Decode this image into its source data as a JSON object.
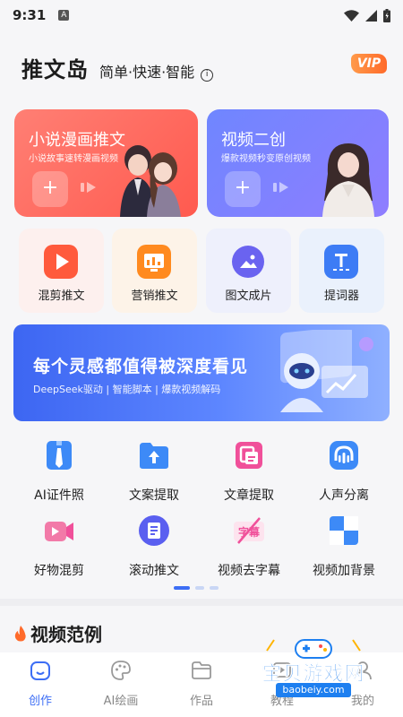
{
  "status_bar": {
    "time": "9:31",
    "notification_badge": "A"
  },
  "header": {
    "title": "推文岛",
    "slogan": "简单·快速·智能",
    "vip_label": "VIP"
  },
  "hero_cards": [
    {
      "title": "小说漫画推文",
      "subtitle": "小说故事速转漫画视频",
      "plus": "+"
    },
    {
      "title": "视频二创",
      "subtitle": "爆款视频秒变原创视频",
      "plus": "+"
    }
  ],
  "quick_tools": [
    {
      "label": "混剪推文",
      "icon": "play-icon",
      "color": "#ff5a3c",
      "bg": "#fdf0ee"
    },
    {
      "label": "营销推文",
      "icon": "marketing-chart-icon",
      "color": "#ff8a1f",
      "bg": "#fdf3e8"
    },
    {
      "label": "图文成片",
      "icon": "image-icon",
      "color": "#6a63f0",
      "bg": "#eef0fc"
    },
    {
      "label": "提词器",
      "icon": "teleprompter-icon",
      "color": "#3d7cf5",
      "bg": "#eaf1fc"
    }
  ],
  "banner": {
    "title": "每个灵感都值得被深度看见",
    "subtitle": "DeepSeek驱动 | 智能脚本 | 爆款视频解码"
  },
  "grid_tools": [
    {
      "label": "AI证件照",
      "icon": "id-photo-icon",
      "color": "#3d8af7"
    },
    {
      "label": "文案提取",
      "icon": "folder-upload-icon",
      "color": "#3d8af7"
    },
    {
      "label": "文章提取",
      "icon": "article-extract-icon",
      "color": "#f0509a"
    },
    {
      "label": "人声分离",
      "icon": "voice-separation-icon",
      "color": "#3d8af7"
    },
    {
      "label": "好物混剪",
      "icon": "product-video-icon",
      "color": "#f0509a"
    },
    {
      "label": "滚动推文",
      "icon": "scroll-text-icon",
      "color": "#5a5ff0"
    },
    {
      "label": "视频去字幕",
      "icon": "remove-subtitle-icon",
      "color": "#f0509a",
      "icon_text": "字幕"
    },
    {
      "label": "视频加背景",
      "icon": "add-background-icon",
      "color": "#3d8af7"
    }
  ],
  "section": {
    "title": "视频范例"
  },
  "bottom_nav": [
    {
      "label": "创作",
      "icon": "create-icon",
      "active": true
    },
    {
      "label": "AI绘画",
      "icon": "palette-icon",
      "active": false
    },
    {
      "label": "作品",
      "icon": "folder-icon",
      "active": false
    },
    {
      "label": "教程",
      "icon": "tutorial-icon",
      "active": false
    },
    {
      "label": "我的",
      "icon": "profile-icon",
      "active": false
    }
  ],
  "watermark": {
    "text": "宝贝游戏网",
    "url": "baobeiy.com"
  },
  "colors": {
    "accent": "#3d6ef5",
    "hero_left": "#ff5a4f",
    "hero_right": "#7d82ff",
    "banner": "#3d66f2"
  }
}
